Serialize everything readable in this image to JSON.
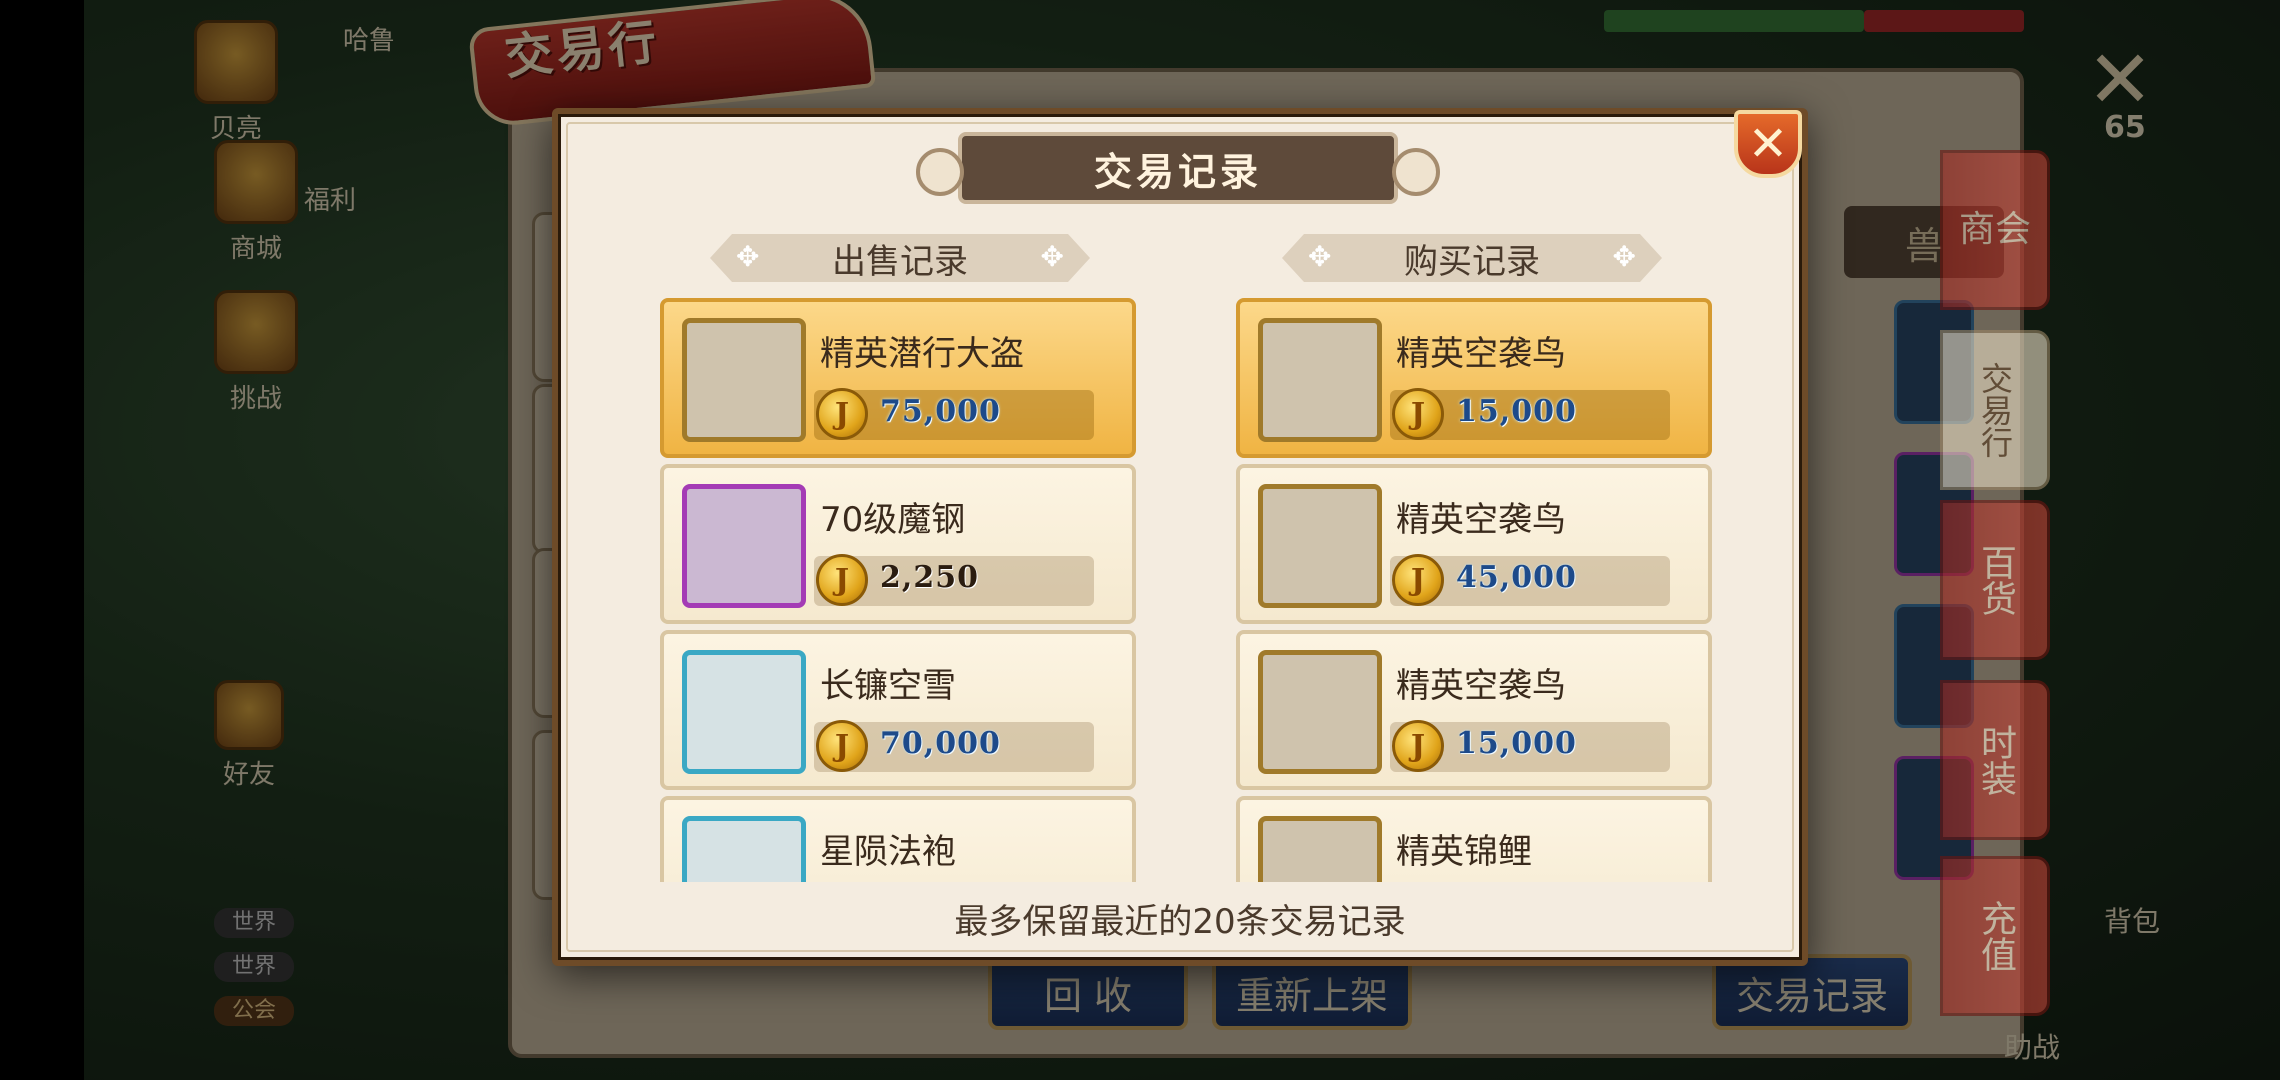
{
  "background": {
    "left_labels": [
      "贝亮",
      "哈鲁",
      "商城",
      "福利",
      "挑战",
      "好友"
    ],
    "trade_title": "交易行",
    "side_tabs": [
      {
        "label": "商会",
        "active": false
      },
      {
        "label": "交易行",
        "active": true
      },
      {
        "label": "百货",
        "active": false
      },
      {
        "label": "时装",
        "active": false
      },
      {
        "label": "充值",
        "active": false
      }
    ],
    "top_right_level": "65",
    "bottom_buttons": {
      "recycle": "回 收",
      "relist": "重新上架",
      "records": "交易记录"
    },
    "chat_tags": [
      "世界",
      "世界",
      "公会"
    ],
    "right_tab_partial": "兽",
    "bag_label": "背包",
    "battle_label": "助战"
  },
  "modal": {
    "title": "交易记录",
    "close_symbol": "✕",
    "sell_header": "出售记录",
    "buy_header": "购买记录",
    "coin_symbol": "J",
    "sell_records": [
      {
        "name": "精英潜行大盗",
        "price": "75,000",
        "highlight": true,
        "price_style": "highlight-blue",
        "thumb": "gold"
      },
      {
        "name": "70级魔钢",
        "price": "2,250",
        "highlight": false,
        "price_style": "dark",
        "thumb": "purple"
      },
      {
        "name": "长镰空雪",
        "price": "70,000",
        "highlight": false,
        "price_style": "blue",
        "thumb": "cyan"
      },
      {
        "name": "星陨法袍",
        "price": "",
        "highlight": false,
        "price_style": "blue",
        "thumb": "cyan"
      }
    ],
    "buy_records": [
      {
        "name": "精英空袭鸟",
        "price": "15,000",
        "highlight": true,
        "price_style": "highlight-blue",
        "thumb": "gold"
      },
      {
        "name": "精英空袭鸟",
        "price": "45,000",
        "highlight": false,
        "price_style": "blue",
        "thumb": "gold"
      },
      {
        "name": "精英空袭鸟",
        "price": "15,000",
        "highlight": false,
        "price_style": "blue",
        "thumb": "gold"
      },
      {
        "name": "精英锦鲤",
        "price": "",
        "highlight": false,
        "price_style": "blue",
        "thumb": "gold"
      }
    ],
    "footer_note": "最多保留最近的20条交易记录"
  }
}
